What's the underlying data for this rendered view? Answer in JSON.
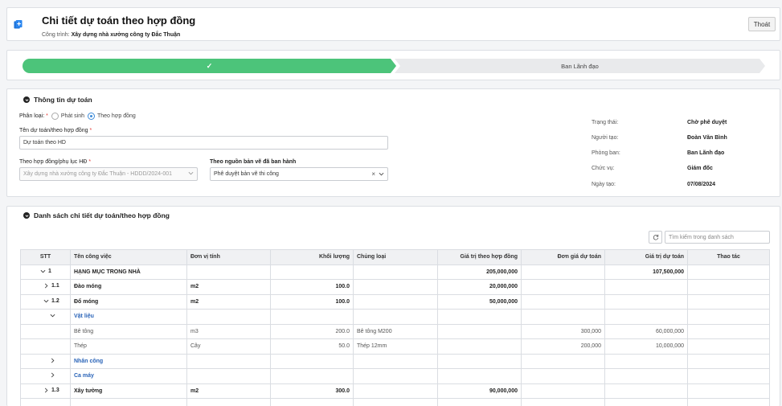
{
  "header": {
    "title": "Chi tiết dự toán theo hợp đồng",
    "project_label": "Công trình:",
    "project_name": "Xây dựng nhà xưởng công ty Đắc Thuận",
    "exit_label": "Thoát"
  },
  "progress": {
    "done_step_icon": "check-icon",
    "next_step_label": "Ban Lãnh đạo",
    "colors": {
      "done": "#4cc47a",
      "pending": "#e9eaec"
    }
  },
  "info": {
    "section_title": "Thông tin dự toán",
    "type_label": "Phân loại:",
    "type_options": [
      "Phát sinh",
      "Theo hợp đồng"
    ],
    "type_selected": "Theo hợp đồng",
    "name_label": "Tên dự toán/theo hợp đồng",
    "name_value": "Dự toán theo HD",
    "contract_label": "Theo hợp đồng/phụ lục HĐ",
    "contract_value": "Xây dựng nhà xưởng công ty Đắc Thuận - HDDD/2024-001",
    "drawing_label": "Theo nguồn bản vẽ đã ban hành",
    "drawing_value": "Phê duyệt bản vẽ thi công",
    "status_rows": [
      {
        "key": "Trạng thái:",
        "value": "Chờ phê duyệt"
      },
      {
        "key": "Người tạo:",
        "value": "Đoàn Văn Bình"
      },
      {
        "key": "Phòng ban:",
        "value": "Ban Lãnh đạo"
      },
      {
        "key": "Chức vụ:",
        "value": "Giám đốc"
      },
      {
        "key": "Ngày tạo:",
        "value": "07/08/2024"
      }
    ]
  },
  "list": {
    "section_title": "Danh sách chi tiết dự toán/theo hợp đồng",
    "search_placeholder": "Tìm kiếm trong danh sách",
    "columns": [
      "STT",
      "Tên công việc",
      "Đơn vị tính",
      "Khối lượng",
      "Chủng loại",
      "Giá trị theo hợp đồng",
      "Đơn giá dự toán",
      "Giá trị dự toán",
      "Thao tác"
    ],
    "rows": [
      {
        "kind": "level1",
        "chev": "down",
        "stt": "1",
        "name": "HẠNG MỤC TRONG NHÀ",
        "unit": "",
        "qty": "",
        "type": "",
        "contract_value": "205,000,000",
        "unit_price": "",
        "estimate_value": "107,500,000"
      },
      {
        "kind": "level2",
        "chev": "right",
        "stt": "1.1",
        "name": "Đào móng",
        "unit": "m2",
        "qty": "100.0",
        "type": "",
        "contract_value": "20,000,000",
        "unit_price": "",
        "estimate_value": ""
      },
      {
        "kind": "level2",
        "chev": "down",
        "stt": "1.2",
        "name": "Đổ móng",
        "unit": "m2",
        "qty": "100.0",
        "type": "",
        "contract_value": "50,000,000",
        "unit_price": "",
        "estimate_value": ""
      },
      {
        "kind": "group",
        "chev": "down",
        "stt": "",
        "name": "Vật liệu",
        "unit": "",
        "qty": "",
        "type": "",
        "contract_value": "",
        "unit_price": "",
        "estimate_value": ""
      },
      {
        "kind": "item",
        "chev": "",
        "stt": "",
        "name": "Bê tông",
        "unit": "m3",
        "qty": "200.0",
        "type": "Bê tông M200",
        "contract_value": "",
        "unit_price": "300,000",
        "estimate_value": "60,000,000"
      },
      {
        "kind": "item",
        "chev": "",
        "stt": "",
        "name": "Thép",
        "unit": "Cây",
        "qty": "50.0",
        "type": "Thép 12mm",
        "contract_value": "",
        "unit_price": "200,000",
        "estimate_value": "10,000,000"
      },
      {
        "kind": "group",
        "chev": "right",
        "stt": "",
        "name": "Nhân công",
        "unit": "",
        "qty": "",
        "type": "",
        "contract_value": "",
        "unit_price": "",
        "estimate_value": ""
      },
      {
        "kind": "group",
        "chev": "right",
        "stt": "",
        "name": "Ca máy",
        "unit": "",
        "qty": "",
        "type": "",
        "contract_value": "",
        "unit_price": "",
        "estimate_value": ""
      },
      {
        "kind": "level2",
        "chev": "right",
        "stt": "1.3",
        "name": "Xây tường",
        "unit": "m2",
        "qty": "300.0",
        "type": "",
        "contract_value": "90,000,000",
        "unit_price": "",
        "estimate_value": ""
      }
    ]
  }
}
